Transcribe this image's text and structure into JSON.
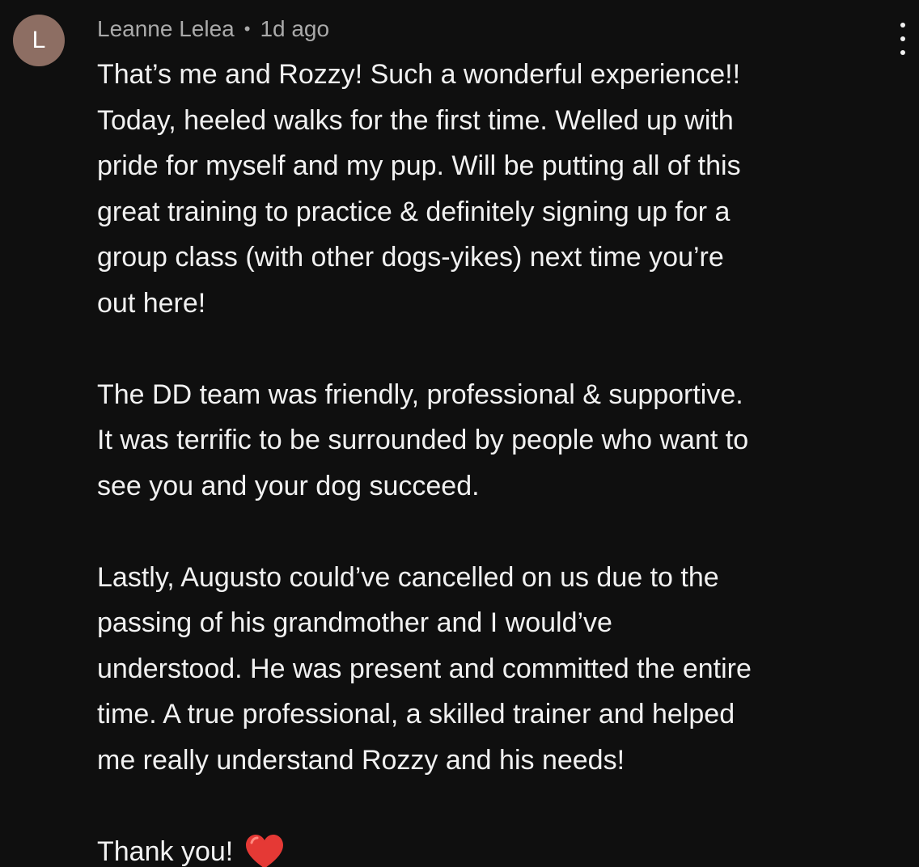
{
  "comment": {
    "avatar_letter": "L",
    "avatar_color": "#8d6e63",
    "author": "Leanne Lelea",
    "separator": "•",
    "timestamp": "1d ago",
    "paragraphs": [
      [
        "That’s me and Rozzy! Such a wonderful experience!!",
        "Today, heeled walks for the first time. Welled up with",
        "pride for myself and my pup. Will be putting all of this",
        "great training to practice & definitely signing up for a",
        "group class (with other dogs-yikes) next time you’re",
        "out here!"
      ],
      [
        "The DD team was friendly, professional & supportive.",
        "It was terrific to be surrounded by people who want to",
        "see you and your dog succeed."
      ],
      [
        "Lastly, Augusto could’ve cancelled on us due to the",
        "passing of his grandmother and I would’ve",
        "understood. He was present and committed the entire",
        "time. A true professional, a skilled trainer and helped",
        "me really understand Rozzy and his needs!"
      ]
    ],
    "closing": "Thank you!",
    "closing_icon": "red-heart-icon",
    "heart_color": "#e53935",
    "more_icon": "more-vertical-icon"
  }
}
